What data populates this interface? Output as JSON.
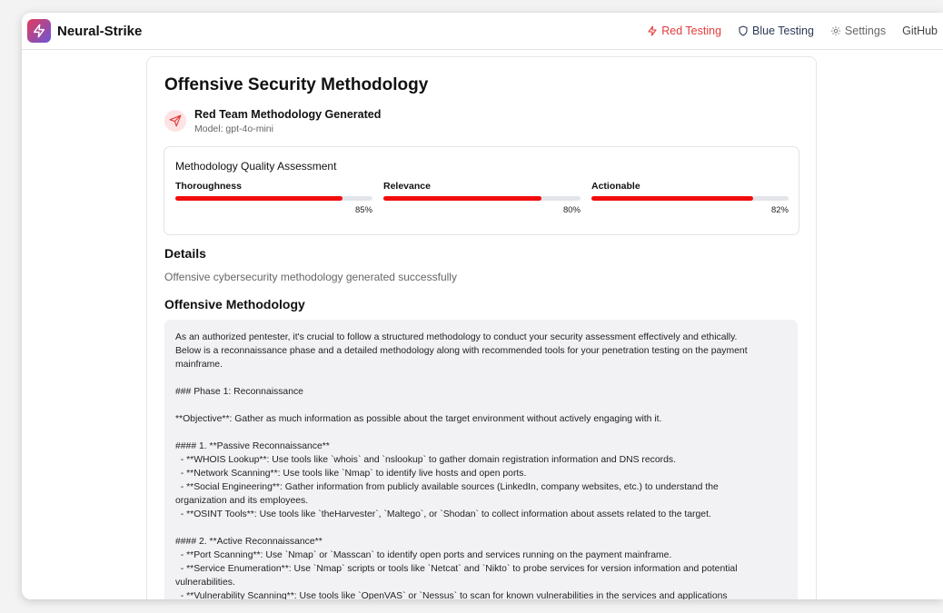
{
  "app": {
    "name": "Neural-Strike",
    "accent_red": "#f20d0d",
    "logo_icon": "lightning-icon"
  },
  "nav": {
    "red_testing": "Red Testing",
    "blue_testing": "Blue Testing",
    "settings": "Settings",
    "github": "GitHub"
  },
  "page": {
    "title": "Offensive Security Methodology"
  },
  "status": {
    "icon": "send-icon",
    "title": "Red Team Methodology Generated",
    "model": "Model: gpt-4o-mini"
  },
  "quality": {
    "title": "Methodology Quality Assessment",
    "metrics": [
      {
        "label": "Thoroughness",
        "value": 85,
        "display": "85%"
      },
      {
        "label": "Relevance",
        "value": 80,
        "display": "80%"
      },
      {
        "label": "Actionable",
        "value": 82,
        "display": "82%"
      }
    ]
  },
  "details": {
    "heading": "Details",
    "text": "Offensive cybersecurity methodology generated successfully"
  },
  "methodology": {
    "heading": "Offensive Methodology",
    "lines": [
      "As an authorized pentester, it's crucial to follow a structured methodology to conduct your security assessment effectively and ethically.",
      "Below is a reconnaissance phase and a detailed methodology along with recommended tools for your penetration testing on the payment",
      "mainframe.",
      "",
      "### Phase 1: Reconnaissance",
      "",
      "**Objective**: Gather as much information as possible about the target environment without actively engaging with it.",
      "",
      "#### 1. **Passive Reconnaissance**",
      "  - **WHOIS Lookup**: Use tools like `whois` and `nslookup` to gather domain registration information and DNS records.",
      "  - **Network Scanning**: Use tools like `Nmap` to identify live hosts and open ports.",
      "  - **Social Engineering**: Gather information from publicly available sources (LinkedIn, company websites, etc.) to understand the",
      "organization and its employees.",
      "  - **OSINT Tools**: Use tools like `theHarvester`, `Maltego`, or `Shodan` to collect information about assets related to the target.",
      "",
      "#### 2. **Active Reconnaissance**",
      "  - **Port Scanning**: Use `Nmap` or `Masscan` to identify open ports and services running on the payment mainframe.",
      "  - **Service Enumeration**: Use `Nmap` scripts or tools like `Netcat` and `Nikto` to probe services for version information and potential",
      "vulnerabilities.",
      "  - **Vulnerability Scanning**: Use tools like `OpenVAS` or `Nessus` to scan for known vulnerabilities in the services and applications"
    ]
  }
}
